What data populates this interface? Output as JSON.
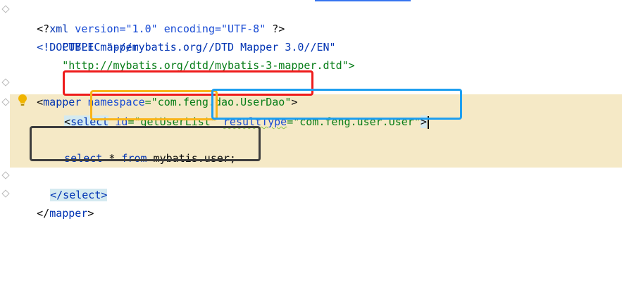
{
  "editor": {
    "lines": [
      {
        "prefix": "<?",
        "tag": "xml",
        "rest": " version=\"1.0\" encoding=\"UTF-8\" ",
        "suffix": "?>"
      },
      {
        "prefix": "<!",
        "tag": "DOCTYPE",
        "rest": " mapper",
        "suffix": ""
      },
      {
        "text": "        PUBLIC \"-//mybatis.org//DTD Mapper 3.0//EN\""
      },
      {
        "text": "        \"http://mybatis.org/dtd/mybatis-3-mapper.dtd\">"
      }
    ],
    "mapper_open": {
      "lt": "<",
      "tag": "mapper",
      "attr_name": "namespace",
      "eq": "=",
      "attr_value": "\"com.feng.dao.UserDao\"",
      "gt": ">"
    },
    "select_open": {
      "lt": "<",
      "tag": "select",
      "id_name": "id",
      "id_value": "\"getUserList\"",
      "rt_name": "resultType",
      "rt_value": "\"com.feng.user.User\"",
      "gt": ">"
    },
    "sql": {
      "kw_select": "select",
      "star": " * ",
      "kw_from": "from",
      "table": " mybatis.user;"
    },
    "select_close": "</select>",
    "mapper_close_lt": "</",
    "mapper_close_tag": "mapper",
    "mapper_close_gt": ">"
  },
  "colors": {
    "highlight_bg": "#f5e9c6",
    "tag_bg": "#d4eaf0",
    "annotation_red": "#ee1b1b",
    "annotation_orange": "#f9b418",
    "annotation_blue": "#1e9ff0",
    "annotation_gray": "#3d3d3d"
  }
}
